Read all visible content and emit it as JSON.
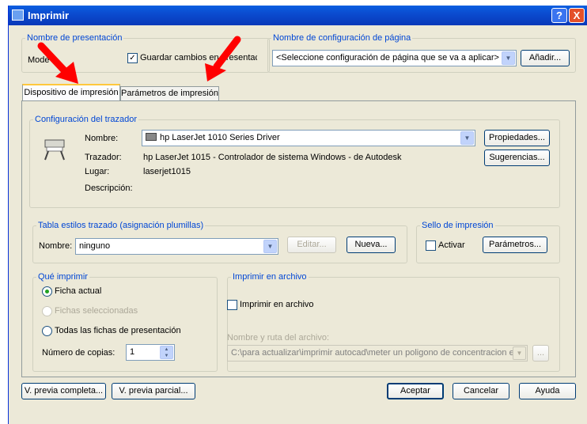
{
  "title": "Imprimir",
  "help_label": "?",
  "close_label": "X",
  "presentation": {
    "group": "Nombre de presentación",
    "model_text": "Mode",
    "save_changes": "Guardar cambios en presentación",
    "checked": true
  },
  "page_setup": {
    "group": "Nombre de configuración de página",
    "value": "<Seleccione configuración de página que se va a aplicar>",
    "add_button": "Añadir..."
  },
  "tabs": [
    {
      "label": "Dispositivo de impresión",
      "active": true
    },
    {
      "label": "Parámetros de impresión",
      "active": false
    }
  ],
  "plotter": {
    "group": "Configuración del trazador",
    "name_label": "Nombre:",
    "name_value": "hp LaserJet 1010 Series Driver",
    "properties_button": "Propiedades...",
    "plotter_label": "Trazador:",
    "plotter_value": "hp LaserJet 1015 - Controlador de sistema Windows - de Autodesk",
    "hints_button": "Sugerencias...",
    "where_label": "Lugar:",
    "where_value": "laserjet1015",
    "desc_label": "Descripción:"
  },
  "plot_style": {
    "group": "Tabla estilos trazado (asignación plumillas)",
    "name_label": "Nombre:",
    "value": "ninguno",
    "edit_button": "Editar...",
    "new_button": "Nueva..."
  },
  "stamp": {
    "group": "Sello de impresión",
    "on_label": "Activar",
    "checked": false,
    "settings_button": "Parámetros..."
  },
  "what_to_plot": {
    "group": "Qué imprimir",
    "current_tab": "Ficha actual",
    "selected_tabs": "Fichas seleccionadas",
    "all_tabs": "Todas las fichas de presentación",
    "selected": "current",
    "copies_label": "Número de copias:",
    "copies": "1"
  },
  "plot_to_file": {
    "group": "Imprimir en archivo",
    "checkbox": "Imprimir en archivo",
    "checked": false,
    "path_label": "Nombre y ruta del archivo:",
    "path_value": "C:\\para actualizar\\imprimir autocad\\meter un poligono de concentracion en",
    "browse": "..."
  },
  "footer": {
    "full_preview": "V. previa completa...",
    "partial_preview": "V. previa parcial...",
    "ok": "Aceptar",
    "cancel": "Cancelar",
    "help": "Ayuda"
  },
  "colors": {
    "titlebar": "#0b4cd0",
    "dialog_bg": "#ece9d8",
    "group_label": "#0046d5",
    "annotation_arrow": "#ff0000"
  }
}
